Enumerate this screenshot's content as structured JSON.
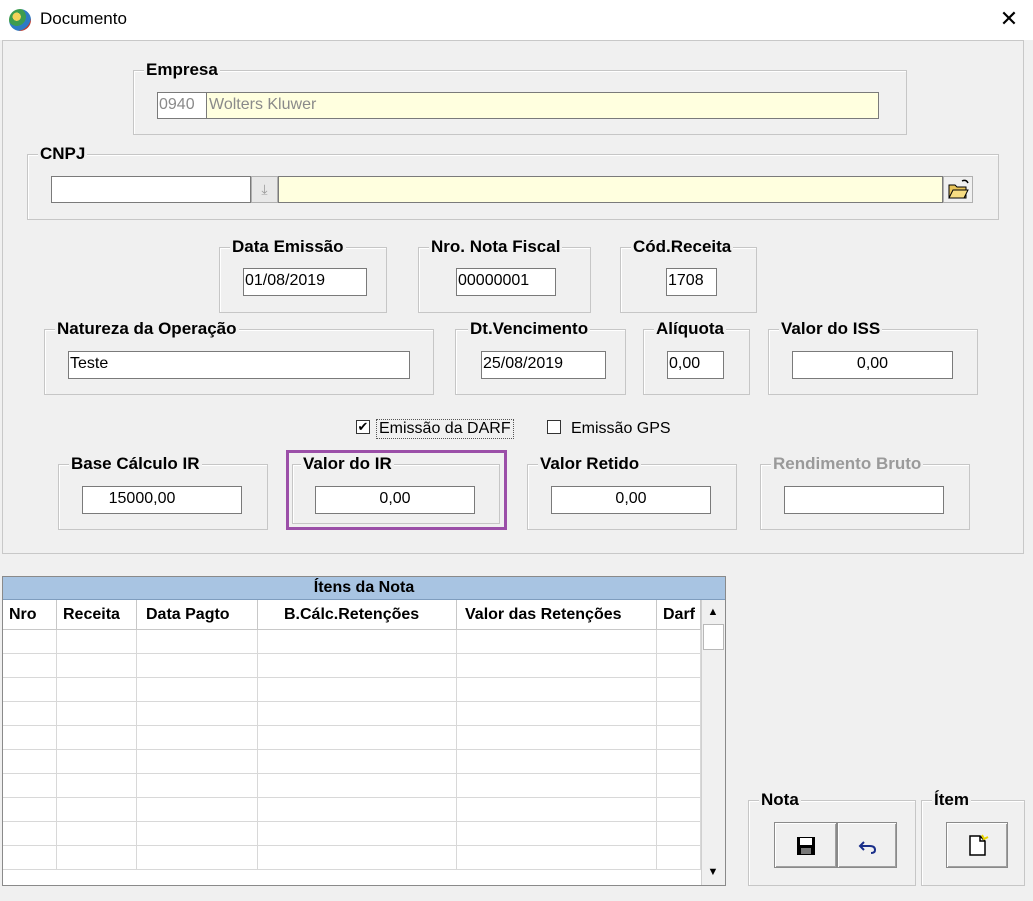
{
  "window": {
    "title": "Documento",
    "close_icon": "close-icon"
  },
  "empresa": {
    "legend": "Empresa",
    "code": "0940",
    "name": "Wolters Kluwer"
  },
  "cnpj": {
    "legend": "CNPJ",
    "value": "",
    "name": ""
  },
  "data_emissao": {
    "legend": "Data Emissão",
    "value": "01/08/2019"
  },
  "nota_fiscal": {
    "legend": "Nro. Nota Fiscal",
    "value": "00000001"
  },
  "cod_receita": {
    "legend": "Cód.Receita",
    "value": "1708"
  },
  "natureza": {
    "legend": "Natureza da Operação",
    "value": "Teste"
  },
  "dt_vencimento": {
    "legend": "Dt.Vencimento",
    "value": "25/08/2019"
  },
  "aliquota": {
    "legend": "Alíquota",
    "value": "0,00"
  },
  "valor_iss": {
    "legend": "Valor do ISS",
    "value": "0,00"
  },
  "emissao_darf": {
    "label": "Emissão da DARF",
    "checked": true
  },
  "emissao_gps": {
    "label": "Emissão GPS",
    "checked": false
  },
  "base_calculo": {
    "legend": "Base Cálculo IR",
    "value": "15000,00"
  },
  "valor_ir": {
    "legend": "Valor do IR",
    "value": "0,00",
    "highlight_color": "#9b4fa8"
  },
  "valor_retido": {
    "legend": "Valor Retido",
    "value": "0,00"
  },
  "rendimento": {
    "legend": "Rendimento Bruto",
    "value": ""
  },
  "grid": {
    "title": "Ítens da Nota",
    "columns": [
      "Nro",
      "Receita",
      "Data Pagto",
      "B.Cálc.Retenções",
      "Valor das Retenções",
      "Darf"
    ],
    "rows": []
  },
  "nota_group": {
    "legend": "Nota",
    "save_icon": "save-icon",
    "undo_icon": "undo-icon"
  },
  "item_group": {
    "legend": "Ítem",
    "new_icon": "new-document-icon"
  }
}
